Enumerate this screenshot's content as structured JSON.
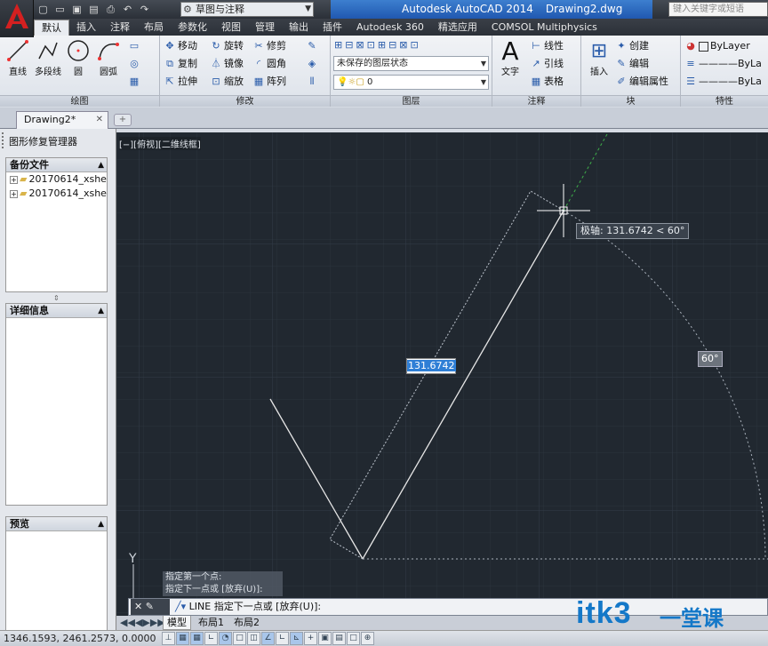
{
  "app": {
    "title": "Autodesk AutoCAD 2014",
    "document": "Drawing2.dwg",
    "workspace": "草图与注释",
    "search_placeholder": "键入关键字或短语"
  },
  "ribbon_tabs": [
    "默认",
    "插入",
    "注释",
    "布局",
    "参数化",
    "视图",
    "管理",
    "输出",
    "插件",
    "Autodesk 360",
    "精选应用",
    "COMSOL Multiphysics"
  ],
  "ribbon": {
    "draw": {
      "title": "绘图",
      "line": "直线",
      "polyline": "多段线",
      "circle": "圆",
      "arc": "圆弧"
    },
    "modify": {
      "title": "修改",
      "move": "移动",
      "rotate": "旋转",
      "trim": "修剪",
      "copy": "复制",
      "mirror": "镜像",
      "fillet": "圆角",
      "stretch": "拉伸",
      "scale": "缩放",
      "array": "阵列"
    },
    "layers": {
      "title": "图层",
      "state": "未保存的图层状态",
      "current": "0"
    },
    "annotation": {
      "title": "注释",
      "text": "文字",
      "linear": "线性",
      "leader": "引线",
      "table": "表格"
    },
    "block": {
      "title": "块",
      "insert": "插入",
      "create": "创建",
      "edit": "编辑",
      "edit_attr": "编辑属性"
    },
    "properties": {
      "title": "特性",
      "color": "ByLayer",
      "linetype": "ByLa",
      "lineweight": "ByLa"
    }
  },
  "doc_tab": "Drawing2*",
  "left_panel": {
    "title": "图形修复管理器",
    "backup_header": "备份文件",
    "files": [
      "20170614_xshe:",
      "20170614_xshe:"
    ],
    "details_header": "详细信息",
    "preview_header": "预览"
  },
  "viewport_label": "[−][俯视][二维线框]",
  "drawing": {
    "polar_tooltip": "极轴: 131.6742 < 60°",
    "dim_input": "131.6742",
    "angle_label": "60°",
    "ucs_y": "Y"
  },
  "command": {
    "history": [
      "指定第一个点:",
      "指定下一点或 [放弃(U)]:"
    ],
    "current": "LINE 指定下一点或 [放弃(U)]:"
  },
  "layout_tabs": [
    "模型",
    "布局1",
    "布局2"
  ],
  "status": {
    "coords": "1346.1593, 2461.2573, 0.0000"
  },
  "watermark": {
    "main": "itk3",
    "suffix": "一堂课"
  }
}
